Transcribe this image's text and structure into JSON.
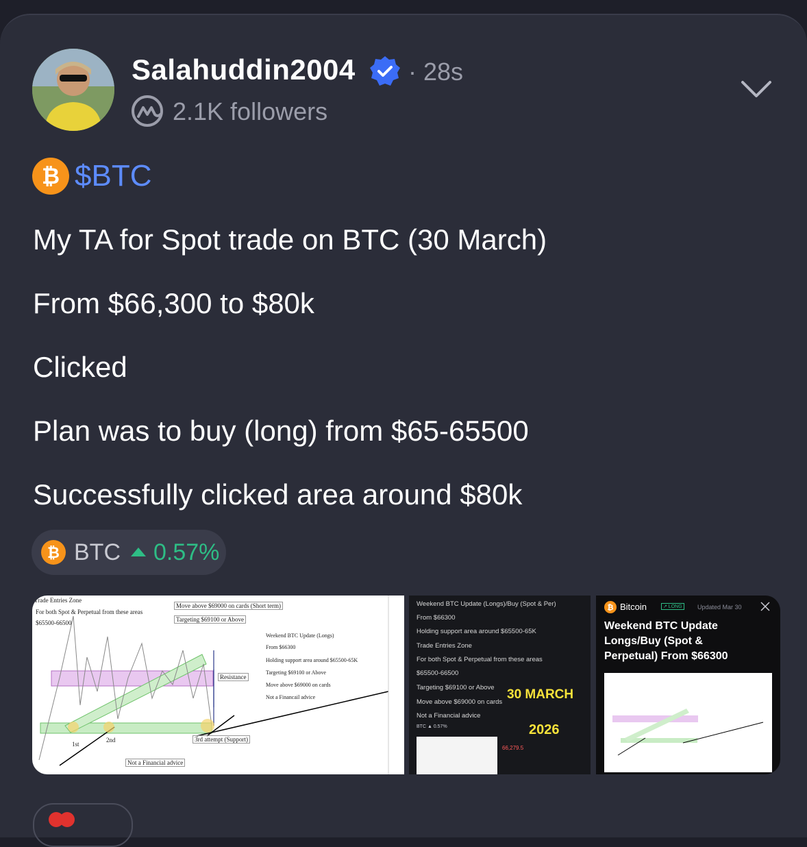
{
  "post": {
    "username": "Salahuddin2004",
    "time": "· 28s",
    "followers": "2.1K followers",
    "cashtag": "$BTC",
    "lines": [
      "My TA for Spot trade on BTC (30 March)",
      "From $66,300 to $80k",
      "Clicked",
      "Plan was to buy (long) from $65-65500",
      "Successfully clicked area around $80k"
    ]
  },
  "ticker": {
    "symbol": "BTC",
    "change": "0.57%",
    "direction": "up"
  },
  "icons": {
    "verified": "verified-badge-icon",
    "platform": "coinmarketcap-icon",
    "menu": "chevron-down-icon",
    "coin": "bitcoin-icon"
  },
  "colors": {
    "accent": "#5d8cff",
    "positive": "#2ebd85",
    "background": "#2b2d39"
  },
  "image1": {
    "zone_title": "Trade Entries Zone",
    "zone_sub": "For both Spot & Perpetual from these areas",
    "zone_range": "$65500-66500",
    "move_above": "Move above $69000 on cards (Short term)",
    "targeting": "Targeting $69100 or Above",
    "update_lines": [
      "Weekend BTC Update (Longs)",
      "From $66300",
      "Holding support area around $65500-65K",
      "Targeting $69100 or Above",
      "Move above $69000 on cards",
      "Not a Financail advice"
    ],
    "resistance": "Resistance",
    "first": "1st",
    "second": "2nd",
    "third": "3rd attempt (Support)",
    "disclaimer": "Not a Financial advice"
  },
  "image2": {
    "lines": [
      "Weekend BTC Update (Longs)/Buy (Spot & Per)",
      "From $66300",
      "Holding support area around $65500-65K",
      "Trade Entries Zone",
      "For both Spot & Perpetual from these areas",
      "$65500-66500",
      "Targeting $69100 or Above",
      "Move above $69000 on cards",
      "Not a Financial advice"
    ],
    "date_big": "30 MARCH",
    "year": "2026",
    "mini_ticker": "BTC ▲ 0.57%",
    "mini_price": "66,279.5"
  },
  "image3": {
    "coin": "Bitcoin",
    "badge": "↗ LONG",
    "updated": "Updated Mar 30",
    "title": "Weekend BTC Update Longs/Buy (Spot & Perpetual) From $66300"
  }
}
